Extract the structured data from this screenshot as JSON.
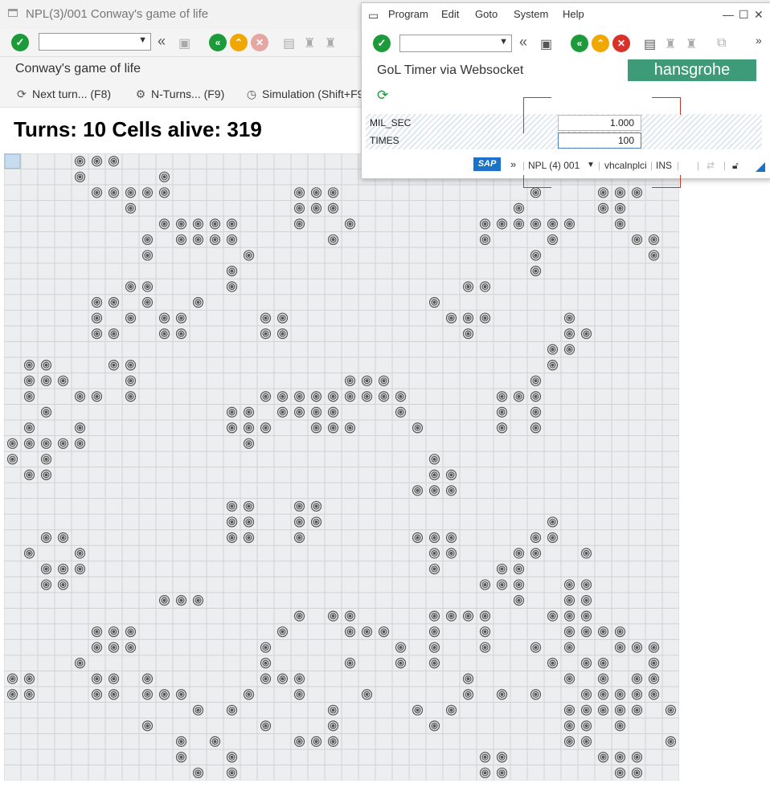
{
  "main": {
    "window_title": "NPL(3)/001 Conway's game of life",
    "app_title": "Conway's game of life",
    "buttons": {
      "next_turn": "Next turn... (F8)",
      "n_turns": "N-Turns... (F9)",
      "simulation": "Simulation (Shift+F9"
    },
    "header_text": "Turns: 10 Cells alive: 319"
  },
  "popup": {
    "menu": [
      "Program",
      "Edit",
      "Goto",
      "System",
      "Help"
    ],
    "title": "GoL Timer via Websocket",
    "logo_text": "hansgrohe",
    "fields": [
      {
        "label": "MIL_SEC",
        "value": "1.000"
      },
      {
        "label": "TIMES",
        "value": "100"
      }
    ],
    "status": {
      "sap_logo": "SAP",
      "system": "NPL (4) 001",
      "server": "vhcalnplci",
      "mode": "INS"
    }
  },
  "icons": {
    "ok": "check-icon",
    "back": "back-icon",
    "exit": "exit-icon",
    "cancel": "cancel-icon",
    "save": "save-icon",
    "print": "print-icon",
    "find": "find-icon",
    "execute": "execute-icon",
    "gear": "gear-icon",
    "clock": "clock-icon",
    "cell": "spiral-cell-icon",
    "lock": "lock-icon"
  },
  "colors": {
    "green": "#1d9b3a",
    "amber": "#f0a800",
    "red": "#d9302a",
    "sap_blue": "#1a73c8",
    "logo_green": "#3d9b79"
  },
  "grid": {
    "cols": 40,
    "rows": 40,
    "selected_cell": [
      0,
      0
    ],
    "alive_rows": [
      [
        4,
        5,
        6
      ],
      [
        4,
        9
      ],
      [
        5,
        6,
        7,
        8,
        9,
        17,
        18,
        19,
        31,
        35,
        36,
        37
      ],
      [
        7,
        17,
        18,
        19,
        30,
        35,
        36
      ],
      [
        9,
        10,
        11,
        12,
        13,
        17,
        20,
        28,
        29,
        30,
        31,
        32,
        33,
        36
      ],
      [
        8,
        10,
        11,
        12,
        13,
        19,
        28,
        32,
        37,
        38
      ],
      [
        8,
        14,
        31,
        38
      ],
      [
        13,
        31
      ],
      [
        7,
        8,
        13,
        27,
        28
      ],
      [
        5,
        6,
        8,
        11,
        25
      ],
      [
        5,
        7,
        9,
        10,
        15,
        16,
        26,
        27,
        28,
        33
      ],
      [
        5,
        6,
        9,
        10,
        15,
        16,
        27,
        33,
        34
      ],
      [
        32,
        33
      ],
      [
        1,
        2,
        6,
        7,
        32
      ],
      [
        1,
        2,
        3,
        7,
        20,
        21,
        22,
        31
      ],
      [
        1,
        4,
        5,
        7,
        15,
        16,
        17,
        18,
        19,
        20,
        21,
        22,
        23,
        29,
        30,
        31
      ],
      [
        2,
        13,
        14,
        16,
        17,
        18,
        19,
        23,
        29,
        31
      ],
      [
        1,
        4,
        13,
        14,
        15,
        18,
        19,
        20,
        24,
        29,
        31
      ],
      [
        0,
        1,
        2,
        3,
        4,
        14
      ],
      [
        0,
        2,
        25
      ],
      [
        1,
        2,
        25,
        26
      ],
      [
        24,
        25,
        26
      ],
      [
        13,
        14,
        17,
        18
      ],
      [
        13,
        14,
        17,
        18,
        32
      ],
      [
        2,
        3,
        13,
        14,
        17,
        24,
        25,
        26,
        31,
        32
      ],
      [
        1,
        4,
        25,
        26,
        30,
        31,
        34
      ],
      [
        2,
        3,
        4,
        25,
        29,
        30
      ],
      [
        2,
        3,
        28,
        29,
        30,
        33,
        34
      ],
      [
        9,
        10,
        11,
        30,
        33,
        34
      ],
      [
        17,
        19,
        20,
        25,
        26,
        27,
        28,
        32,
        33,
        34
      ],
      [
        5,
        6,
        7,
        16,
        20,
        21,
        22,
        25,
        28,
        33,
        34,
        35,
        36
      ],
      [
        5,
        6,
        7,
        15,
        23,
        25,
        28,
        31,
        33,
        36,
        37,
        38
      ],
      [
        4,
        15,
        20,
        23,
        25,
        32,
        34,
        35,
        38
      ],
      [
        0,
        1,
        5,
        6,
        8,
        15,
        16,
        17,
        27,
        33,
        35,
        37,
        38
      ],
      [
        0,
        1,
        5,
        6,
        8,
        9,
        10,
        14,
        17,
        21,
        27,
        29,
        31,
        34,
        35,
        36,
        37,
        38
      ],
      [
        11,
        13,
        19,
        24,
        26,
        33,
        34,
        35,
        36,
        37,
        39
      ],
      [
        8,
        15,
        19,
        25,
        33,
        34,
        36
      ],
      [
        10,
        12,
        17,
        18,
        19,
        33,
        34,
        39
      ],
      [
        10,
        13,
        28,
        29,
        35,
        36,
        37
      ],
      [
        11,
        13,
        28,
        29,
        36,
        37
      ]
    ]
  }
}
